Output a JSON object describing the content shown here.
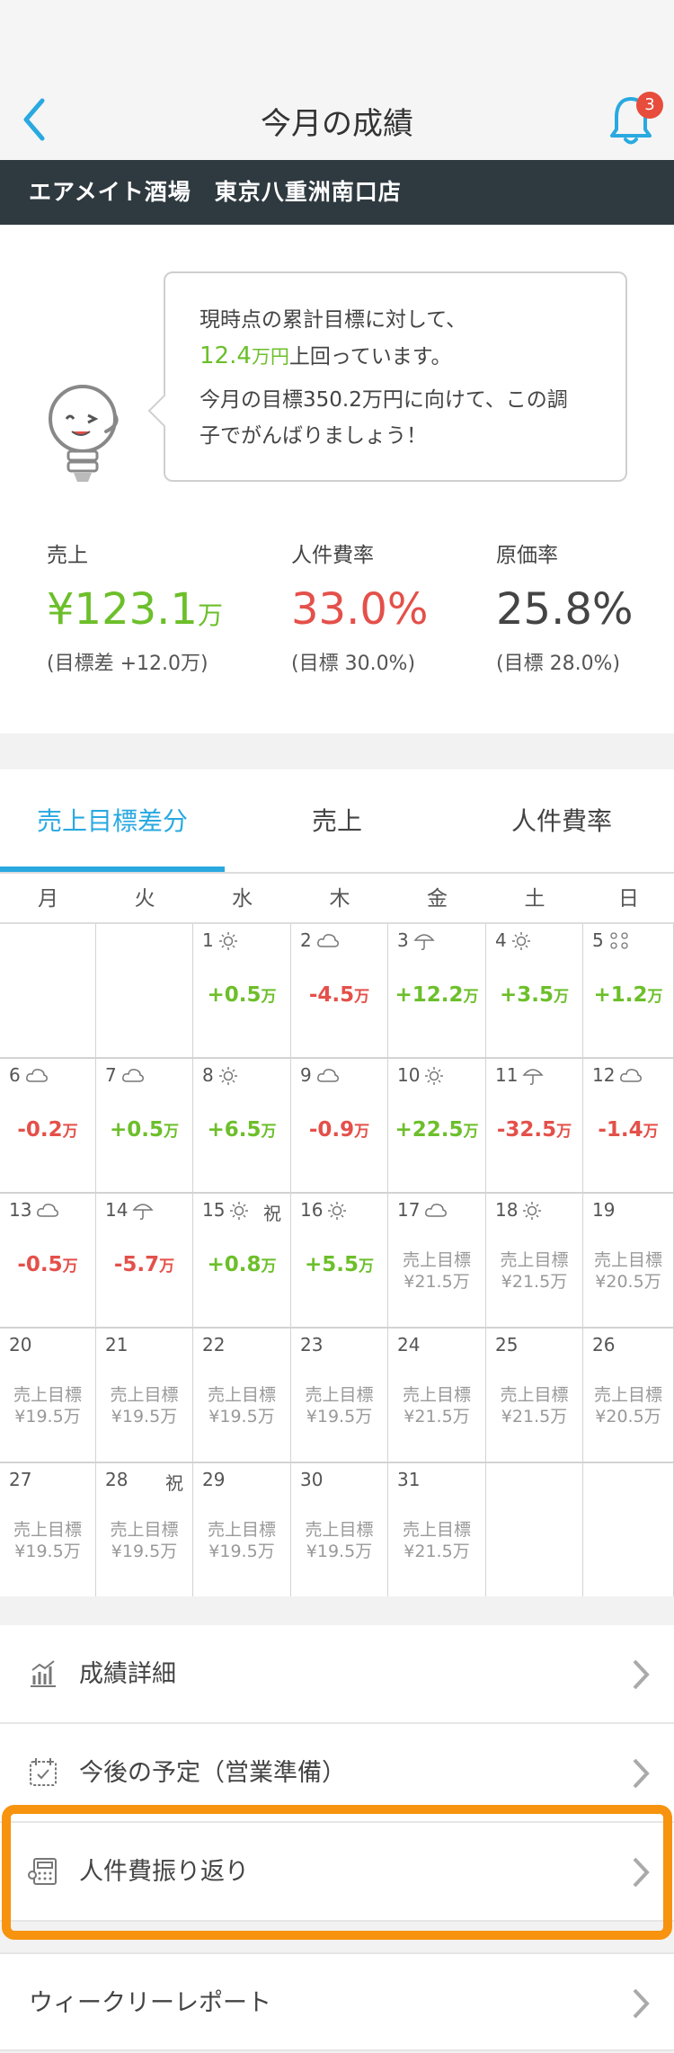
{
  "header": {
    "title": "今月の成績",
    "notification_count": "3"
  },
  "store": {
    "name": "エアメイト酒場　東京八重洲南口店"
  },
  "summary": {
    "line1": "現時点の累計目標に対して、",
    "line2_amount": "12.4",
    "line2_unit": "万円",
    "line2_suffix": "上回っています。",
    "line3": "今月の目標350.2万円に向けて、この調",
    "line4": "子でがんばりましょう！"
  },
  "metrics": {
    "sales": {
      "label": "売上",
      "prefix": "¥",
      "value": "123.1",
      "unit": "万",
      "sub": "(目標差 +12.0万)",
      "color": "#6cbf2a"
    },
    "labor": {
      "label": "人件費率",
      "value": "33.0%",
      "sub": "(目標 30.0%)",
      "color": "#e4504a"
    },
    "cost": {
      "label": "原価率",
      "value": "25.8%",
      "sub": "(目標 28.0%)",
      "color": "#444444"
    }
  },
  "tabs": [
    "売上目標差分",
    "売上",
    "人件費率"
  ],
  "active_tab": 0,
  "weekdays": [
    "月",
    "火",
    "水",
    "木",
    "金",
    "土",
    "日"
  ],
  "calendar": [
    {
      "day": "1",
      "weather": "sun",
      "delta": "+0.5",
      "sign": "pos"
    },
    {
      "day": "2",
      "weather": "cloud",
      "delta": "-4.5",
      "sign": "neg"
    },
    {
      "day": "3",
      "weather": "umbrella",
      "delta": "+12.2",
      "sign": "pos"
    },
    {
      "day": "4",
      "weather": "sun",
      "delta": "+3.5",
      "sign": "pos"
    },
    {
      "day": "5",
      "weather": "snow",
      "delta": "+1.2",
      "sign": "pos"
    },
    {
      "day": "6",
      "weather": "cloud",
      "delta": "-0.2",
      "sign": "neg"
    },
    {
      "day": "7",
      "weather": "cloud",
      "delta": "+0.5",
      "sign": "pos"
    },
    {
      "day": "8",
      "weather": "sun",
      "delta": "+6.5",
      "sign": "pos"
    },
    {
      "day": "9",
      "weather": "cloud",
      "delta": "-0.9",
      "sign": "neg"
    },
    {
      "day": "10",
      "weather": "sun",
      "delta": "+22.5",
      "sign": "pos"
    },
    {
      "day": "11",
      "weather": "umbrella",
      "delta": "-32.5",
      "sign": "neg"
    },
    {
      "day": "12",
      "weather": "cloud",
      "delta": "-1.4",
      "sign": "neg"
    },
    {
      "day": "13",
      "weather": "cloud",
      "delta": "-0.5",
      "sign": "neg"
    },
    {
      "day": "14",
      "weather": "umbrella",
      "delta": "-5.7",
      "sign": "neg"
    },
    {
      "day": "15",
      "weather": "sun",
      "holiday": "祝",
      "delta": "+0.8",
      "sign": "pos"
    },
    {
      "day": "16",
      "weather": "sun",
      "delta": "+5.5",
      "sign": "pos"
    },
    {
      "day": "17",
      "weather": "cloud",
      "target": "¥21.5万"
    },
    {
      "day": "18",
      "weather": "sun",
      "target": "¥21.5万"
    },
    {
      "day": "19",
      "target": "¥20.5万"
    },
    {
      "day": "20",
      "target": "¥19.5万"
    },
    {
      "day": "21",
      "target": "¥19.5万"
    },
    {
      "day": "22",
      "target": "¥19.5万"
    },
    {
      "day": "23",
      "target": "¥19.5万"
    },
    {
      "day": "24",
      "target": "¥21.5万"
    },
    {
      "day": "25",
      "target": "¥21.5万"
    },
    {
      "day": "26",
      "target": "¥20.5万"
    },
    {
      "day": "27",
      "target": "¥19.5万"
    },
    {
      "day": "28",
      "holiday": "祝",
      "target": "¥19.5万"
    },
    {
      "day": "29",
      "target": "¥19.5万"
    },
    {
      "day": "30",
      "target": "¥19.5万"
    },
    {
      "day": "31",
      "target": "¥21.5万"
    }
  ],
  "delta_unit": "万",
  "target_label": "売上目標",
  "menu": [
    {
      "label": "成績詳細",
      "icon": "chart-icon"
    },
    {
      "label": "今後の予定（営業準備）",
      "icon": "calendar-icon"
    },
    {
      "label": "人件費振り返り",
      "icon": "calculator-icon"
    },
    {
      "label": "ウィークリーレポート",
      "icon": ""
    }
  ],
  "colors": {
    "accent": "#29a9e0",
    "positive": "#6cbf2a",
    "negative": "#e4504a",
    "highlight": "#f7930e",
    "store_bar": "#2f3a40"
  }
}
